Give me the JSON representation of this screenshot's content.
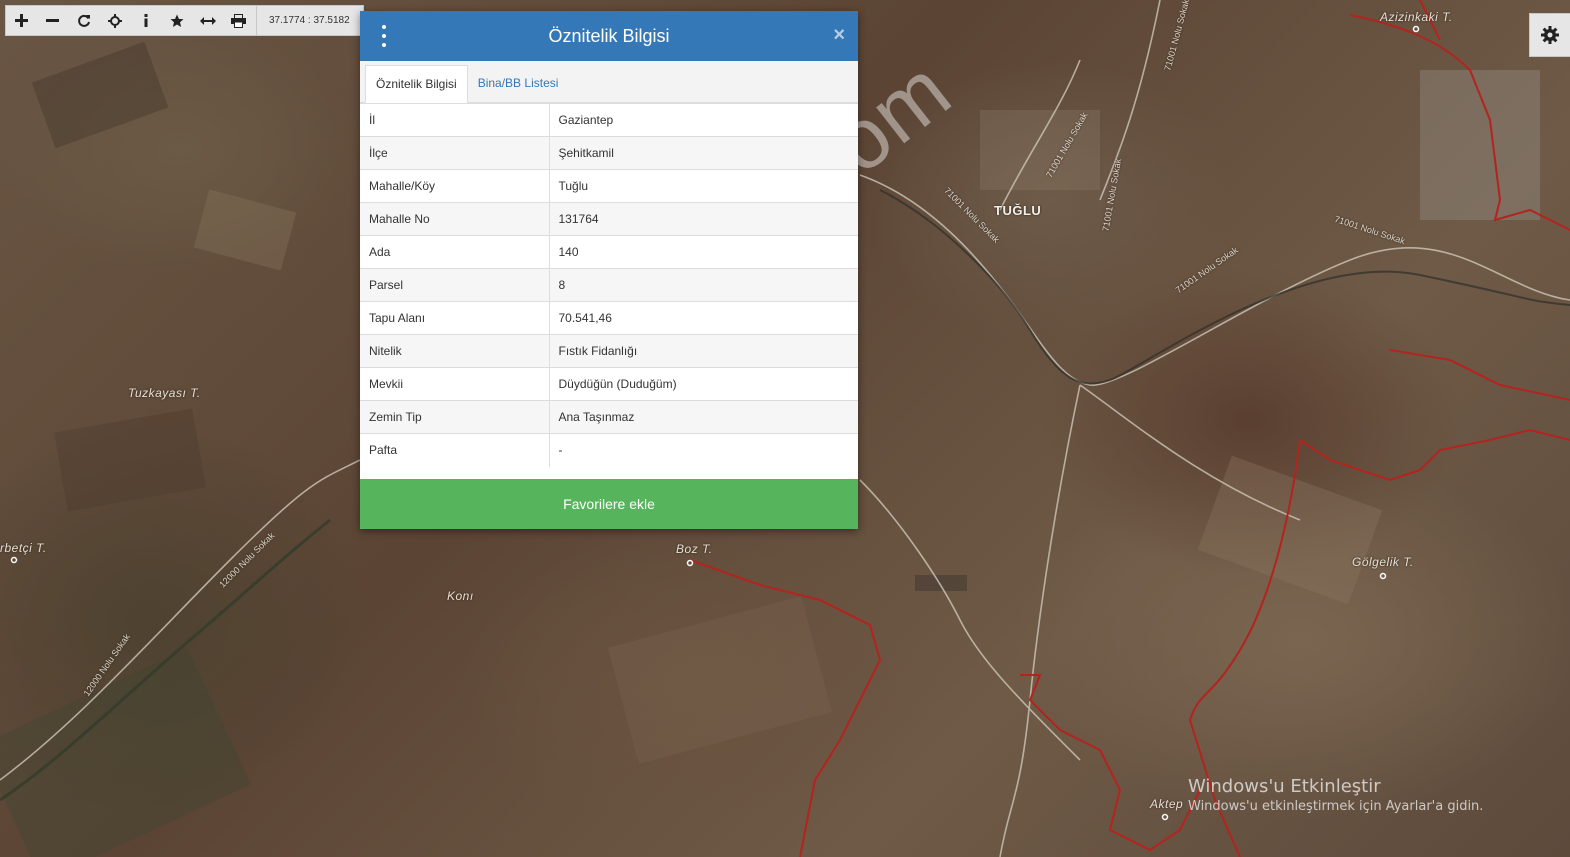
{
  "toolbar": {
    "buttons": [
      {
        "name": "zoom-in-button",
        "icon": "plus-icon"
      },
      {
        "name": "zoom-out-button",
        "icon": "minus-icon"
      },
      {
        "name": "refresh-button",
        "icon": "refresh-icon"
      },
      {
        "name": "locate-button",
        "icon": "crosshair-icon"
      },
      {
        "name": "info-button",
        "icon": "info-icon"
      },
      {
        "name": "favorites-button",
        "icon": "star-icon"
      },
      {
        "name": "measure-button",
        "icon": "arrows-horizontal-icon"
      },
      {
        "name": "print-button",
        "icon": "print-icon"
      }
    ],
    "coordinates": "37.1774 : 37.5182"
  },
  "map": {
    "labels": {
      "azizinkaki": "Azizinkaki T.",
      "tuglu": "TUĞLU",
      "tuzkayasi": "Tuzkayası T.",
      "erbetci": "rbetçi T.",
      "boz": "Boz T.",
      "koni": "Konı",
      "golgelik": "Gölgelik T.",
      "aktepe": "Aktep"
    },
    "roads": {
      "r1": "71001 Nolu Sokak",
      "r2": "71001 Nolu Sokak",
      "r3": "71001 Nolu Sokak",
      "r4": "71001 Nolu Sokak",
      "r5": "71001 Nolu Sokak",
      "r6": "12000 Nolu Sokak",
      "r7": "12000 Nolu Sokak",
      "r8": "71001 Nolu Sokak"
    },
    "watermark": "emlakjet.com",
    "boundary_color": "#b5231e"
  },
  "dialog": {
    "title": "Öznitelik Bilgisi",
    "close_symbol": "×",
    "tabs": [
      {
        "label": "Öznitelik Bilgisi",
        "active": true
      },
      {
        "label": "Bina/BB Listesi",
        "active": false
      }
    ],
    "rows": [
      {
        "key": "İl",
        "value": "Gaziantep"
      },
      {
        "key": "İlçe",
        "value": "Şehitkamil"
      },
      {
        "key": "Mahalle/Köy",
        "value": "Tuğlu"
      },
      {
        "key": "Mahalle No",
        "value": "131764"
      },
      {
        "key": "Ada",
        "value": "140"
      },
      {
        "key": "Parsel",
        "value": "8"
      },
      {
        "key": "Tapu Alanı",
        "value": "70.541,46"
      },
      {
        "key": "Nitelik",
        "value": "Fıstık Fidanlığı"
      },
      {
        "key": "Mevkii",
        "value": "Düydüğün (Duduğüm)"
      },
      {
        "key": "Zemin Tip",
        "value": "Ana Taşınmaz"
      },
      {
        "key": "Pafta",
        "value": "-"
      }
    ],
    "favorite_button": "Favorilere ekle",
    "header_color": "#3478b8",
    "button_color": "#56b55c"
  },
  "settings": {
    "icon": "gear-icon"
  },
  "windows_activation": {
    "title": "Windows'u Etkinleştir",
    "subtitle": "Windows'u etkinleştirmek için Ayarlar'a gidin."
  }
}
